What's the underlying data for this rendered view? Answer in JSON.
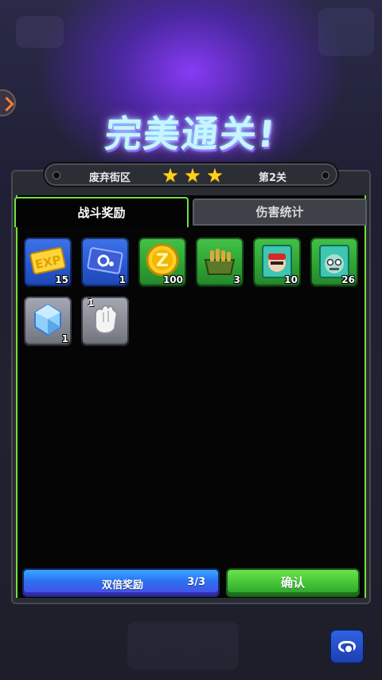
{
  "header": {
    "title": "完美通关!"
  },
  "stage_bar": {
    "stage_name": "废弃街区",
    "stars": 3,
    "level": "第2关"
  },
  "tabs": [
    {
      "label": "战斗奖励",
      "active": true
    },
    {
      "label": "伤害统计",
      "active": false
    }
  ],
  "rewards": [
    {
      "name": "exp-card",
      "rarity": "blue",
      "count": "15"
    },
    {
      "name": "gear-ticket",
      "rarity": "blue",
      "count": "1"
    },
    {
      "name": "gold-coin",
      "rarity": "green",
      "count": "100"
    },
    {
      "name": "ammo-crate",
      "rarity": "green",
      "count": "3"
    },
    {
      "name": "hero-exp-card-red",
      "rarity": "green",
      "count": "10"
    },
    {
      "name": "hero-exp-card-zombie",
      "rarity": "green",
      "count": "26"
    },
    {
      "name": "crystal-gem",
      "rarity": "gray",
      "count": "1"
    },
    {
      "name": "white-gloves",
      "rarity": "gray",
      "count": "1"
    }
  ],
  "buttons": {
    "double_label": "双倍奖励",
    "double_count": "3/3",
    "confirm_label": "确认"
  },
  "colors": {
    "accent_green": "#6fe03a",
    "button_blue": "#2c6ff0",
    "button_green": "#3fbf34",
    "star_yellow": "#ffd21a"
  }
}
